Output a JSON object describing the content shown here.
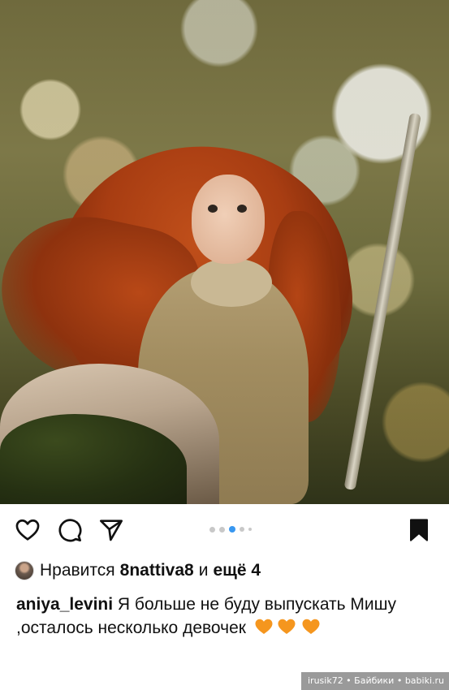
{
  "post": {
    "photo": {
      "subject": "doll-photo"
    },
    "actions": {
      "like_icon": "heart-icon",
      "comment_icon": "comment-icon",
      "share_icon": "paper-plane-icon",
      "save_icon": "bookmark-icon",
      "carousel_total": 5,
      "carousel_active": 3,
      "active_dot_color": "#3897f0"
    },
    "likes": {
      "prefix": "Нравится",
      "user": "8nattiva8",
      "connector": "и",
      "more": "ещё 4"
    },
    "caption": {
      "username": "aniya_levini",
      "text": "Я больше не буду выпускать Мишу ,осталось несколько девочек",
      "emoji": [
        "orange-heart",
        "orange-heart",
        "orange-heart"
      ],
      "emoji_color": "#f5961e"
    }
  },
  "watermark": {
    "text": "irusik72 • Байбики • babiki.ru"
  }
}
